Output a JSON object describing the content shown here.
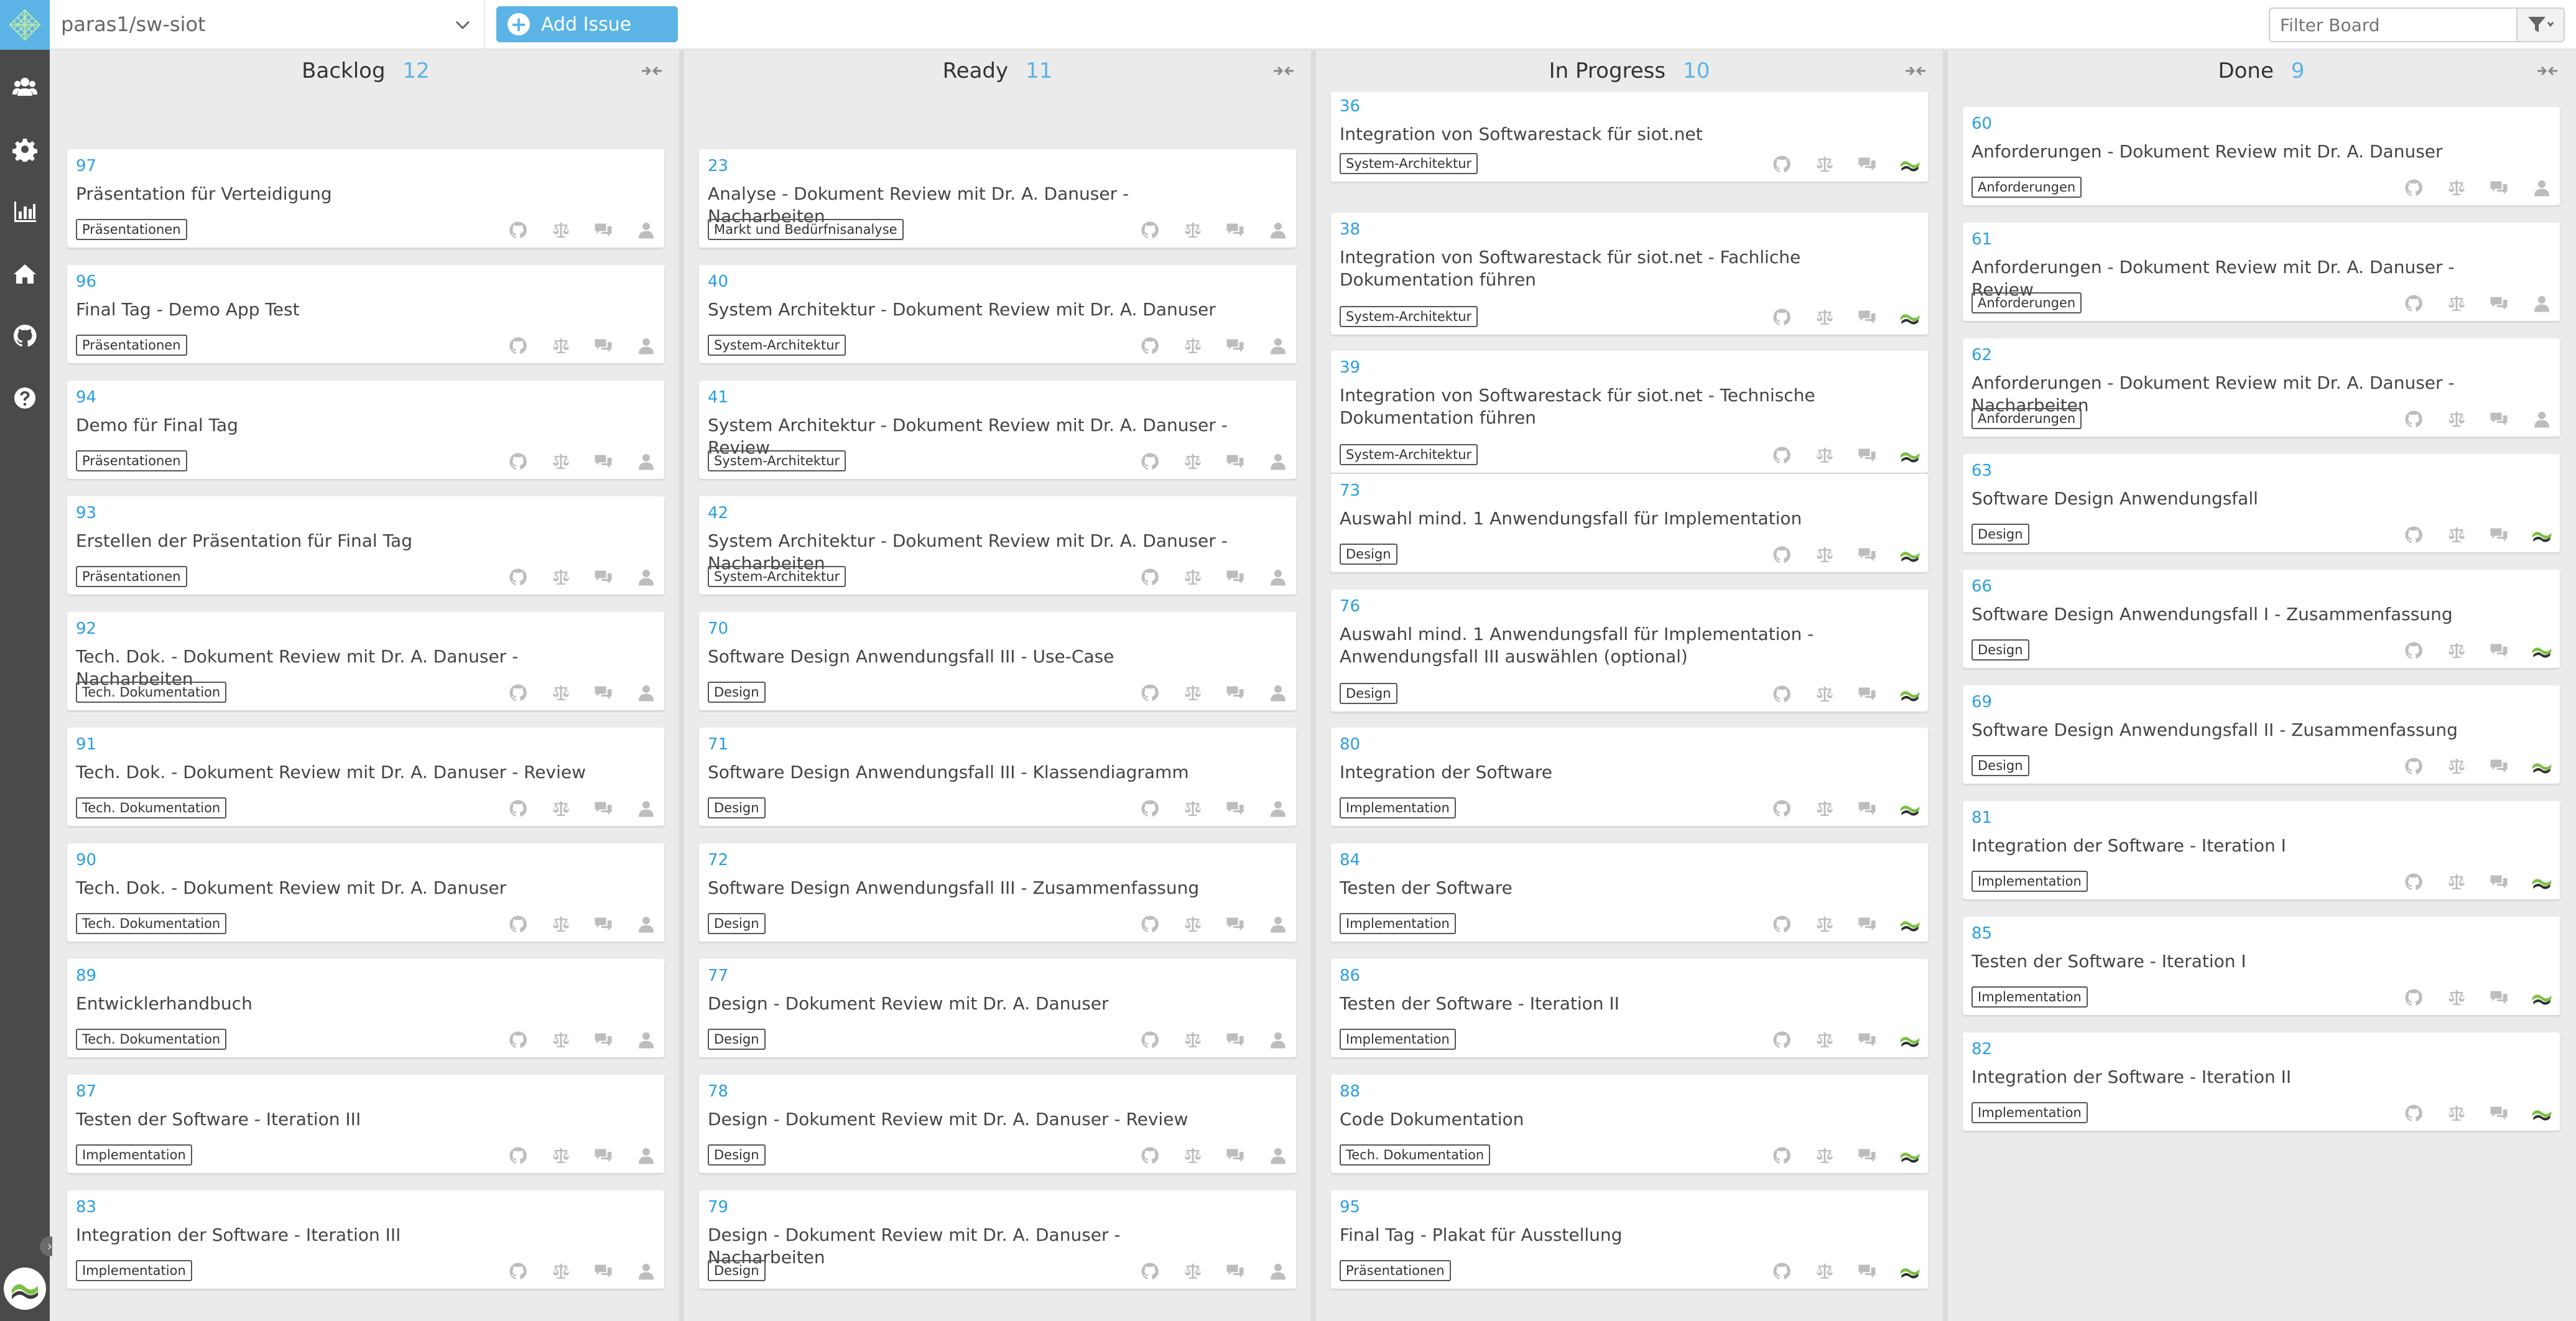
{
  "app": {
    "repo": "paras1/sw-siot",
    "add_issue_label": "Add Issue",
    "filter_placeholder": "Filter Board"
  },
  "sidebar": {
    "items": [
      "users-icon",
      "gear-icon",
      "bar-chart-icon",
      "home-icon",
      "github-icon",
      "help-icon"
    ]
  },
  "colors": {
    "accent": "#5bb4e5",
    "number": "#2a9fe0",
    "sidebar": "#4a4a4a"
  },
  "columns": [
    {
      "title": "Backlog",
      "count": "12",
      "cards": [
        {
          "num": "",
          "title": "",
          "tag": "",
          "assignee": "none"
        },
        {
          "num": "97",
          "title": "Präsentation für Verteidigung",
          "tag": "Präsentationen",
          "assignee": "none"
        },
        {
          "num": "96",
          "title": "Final Tag - Demo App Test",
          "tag": "Präsentationen",
          "assignee": "none"
        },
        {
          "num": "94",
          "title": "Demo für Final Tag",
          "tag": "Präsentationen",
          "assignee": "none"
        },
        {
          "num": "93",
          "title": "Erstellen der Präsentation für Final Tag",
          "tag": "Präsentationen",
          "assignee": "none"
        },
        {
          "num": "92",
          "title": "Tech. Dok. - Dokument Review mit Dr. A. Danuser - Nacharbeiten",
          "tag": "Tech. Dokumentation",
          "assignee": "none"
        },
        {
          "num": "91",
          "title": "Tech. Dok. - Dokument Review mit Dr. A. Danuser - Review",
          "tag": "Tech. Dokumentation",
          "assignee": "none"
        },
        {
          "num": "90",
          "title": "Tech. Dok. - Dokument Review mit Dr. A. Danuser",
          "tag": "Tech. Dokumentation",
          "assignee": "none"
        },
        {
          "num": "89",
          "title": "Entwicklerhandbuch",
          "tag": "Tech. Dokumentation",
          "assignee": "none"
        },
        {
          "num": "87",
          "title": "Testen der Software - Iteration III",
          "tag": "Implementation",
          "assignee": "none"
        },
        {
          "num": "83",
          "title": "Integration der Software - Iteration III",
          "tag": "Implementation",
          "assignee": "none"
        }
      ]
    },
    {
      "title": "Ready",
      "count": "11",
      "cards": [
        {
          "num": "",
          "title": "",
          "tag": "Markt und Bedürfnisanalyse",
          "assignee": "none"
        },
        {
          "num": "23",
          "title": "Analyse - Dokument Review mit Dr. A. Danuser - Nacharbeiten",
          "tag": "Markt und Bedürfnisanalyse",
          "assignee": "none"
        },
        {
          "num": "40",
          "title": "System Architektur - Dokument Review mit Dr. A. Danuser",
          "tag": "System-Architektur",
          "assignee": "none"
        },
        {
          "num": "41",
          "title": "System Architektur - Dokument Review mit Dr. A. Danuser - Review",
          "tag": "System-Architektur",
          "assignee": "none"
        },
        {
          "num": "42",
          "title": "System Architektur - Dokument Review mit Dr. A. Danuser - Nacharbeiten",
          "tag": "System-Architektur",
          "assignee": "none"
        },
        {
          "num": "70",
          "title": "Software Design Anwendungsfall III - Use-Case",
          "tag": "Design",
          "assignee": "none"
        },
        {
          "num": "71",
          "title": "Software Design Anwendungsfall III - Klassendiagramm",
          "tag": "Design",
          "assignee": "none"
        },
        {
          "num": "72",
          "title": "Software Design Anwendungsfall III - Zusammenfassung",
          "tag": "Design",
          "assignee": "none"
        },
        {
          "num": "77",
          "title": "Design - Dokument Review mit Dr. A. Danuser",
          "tag": "Design",
          "assignee": "none"
        },
        {
          "num": "78",
          "title": "Design - Dokument Review mit Dr. A. Danuser - Review",
          "tag": "Design",
          "assignee": "none"
        },
        {
          "num": "79",
          "title": "Design - Dokument Review mit Dr. A. Danuser - Nacharbeiten",
          "tag": "Design",
          "assignee": "none"
        }
      ]
    },
    {
      "title": "In Progress",
      "count": "10",
      "cards": [
        {
          "num": "36",
          "title": "Integration von Softwarestack für siot.net",
          "tag": "System-Architektur",
          "assignee": "user"
        },
        {
          "num": "38",
          "title": "Integration von Softwarestack für siot.net - Fachliche Dokumentation führen",
          "tag": "System-Architektur",
          "assignee": "user"
        },
        {
          "num": "39",
          "title": "Integration von Softwarestack für siot.net - Technische Dokumentation führen",
          "tag": "System-Architektur",
          "assignee": "user"
        },
        {
          "num": "73",
          "title": "Auswahl mind. 1 Anwendungsfall für Implementation",
          "tag": "Design",
          "assignee": "user"
        },
        {
          "num": "76",
          "title": "Auswahl mind. 1 Anwendungsfall für Implementation - Anwendungsfall III auswählen (optional)",
          "tag": "Design",
          "assignee": "user"
        },
        {
          "num": "80",
          "title": "Integration der Software",
          "tag": "Implementation",
          "assignee": "user"
        },
        {
          "num": "84",
          "title": "Testen der Software",
          "tag": "Implementation",
          "assignee": "user"
        },
        {
          "num": "86",
          "title": "Testen der Software - Iteration II",
          "tag": "Implementation",
          "assignee": "user"
        },
        {
          "num": "88",
          "title": "Code Dokumentation",
          "tag": "Tech. Dokumentation",
          "assignee": "user"
        },
        {
          "num": "95",
          "title": "Final Tag - Plakat für Ausstellung",
          "tag": "Präsentationen",
          "assignee": "user"
        }
      ]
    },
    {
      "title": "Done",
      "count": "9",
      "cards": [
        {
          "num": "60",
          "title": "Anforderungen - Dokument Review mit Dr. A. Danuser",
          "tag": "Anforderungen",
          "assignee": "none"
        },
        {
          "num": "61",
          "title": "Anforderungen - Dokument Review mit Dr. A. Danuser - Review",
          "tag": "Anforderungen",
          "assignee": "none"
        },
        {
          "num": "62",
          "title": "Anforderungen - Dokument Review mit Dr. A. Danuser - Nacharbeiten",
          "tag": "Anforderungen",
          "assignee": "none"
        },
        {
          "num": "63",
          "title": "Software Design Anwendungsfall",
          "tag": "Design",
          "assignee": "user"
        },
        {
          "num": "66",
          "title": "Software Design Anwendungsfall I - Zusammenfassung",
          "tag": "Design",
          "assignee": "user"
        },
        {
          "num": "69",
          "title": "Software Design Anwendungsfall II - Zusammenfassung",
          "tag": "Design",
          "assignee": "user"
        },
        {
          "num": "81",
          "title": "Integration der Software - Iteration I",
          "tag": "Implementation",
          "assignee": "user"
        },
        {
          "num": "85",
          "title": "Testen der Software - Iteration I",
          "tag": "Implementation",
          "assignee": "user"
        },
        {
          "num": "82",
          "title": "Integration der Software - Iteration II",
          "tag": "Implementation",
          "assignee": "user"
        }
      ]
    }
  ]
}
